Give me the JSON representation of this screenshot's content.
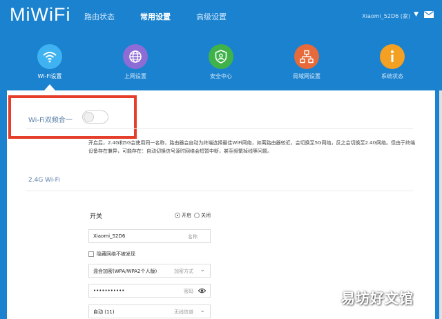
{
  "header": {
    "logo": "MiWiFi",
    "nav": [
      "路由状态",
      "常用设置",
      "高级设置"
    ],
    "active_nav": 1,
    "user": "Xiaomi_52D6 (家)",
    "chevron_icon": "chevron-down-icon",
    "mail_icon": "mail-icon"
  },
  "icons": [
    {
      "label": "Wi-Fi设置",
      "icon": "wifi-icon",
      "color": "#3fb3f2"
    },
    {
      "label": "上网设置",
      "icon": "globe-icon",
      "color": "#8e6cd6"
    },
    {
      "label": "安全中心",
      "icon": "shield-icon",
      "color": "#3fb34a"
    },
    {
      "label": "局域网设置",
      "icon": "network-icon",
      "color": "#e76a3a"
    },
    {
      "label": "系统状态",
      "icon": "info-icon",
      "color": "#f3a023"
    }
  ],
  "dual_band": {
    "label": "Wi-Fi双频合一",
    "enabled": false,
    "description": "开启后，2.4G和5G会使用同一名称，路由器会自动为终端选择最佳WiFi网络，如离路由器较近，会切换至5G网络，反之会切换至2.4G网络。但由于终端设备存在兼异，可能存在：自动切换信号源时网络会短暂中断，甚至频繁掉线等问题。"
  },
  "wifi24": {
    "title": "2.4G Wi-Fi",
    "switch_label": "开关",
    "on_label": "开启",
    "off_label": "关闭",
    "name_value": "Xiaomi_52D6",
    "name_hint": "名称",
    "hide_label": "隐藏网络不被发现",
    "encryption_value": "混合加密(WPA/WPA2个人版)",
    "encryption_hint": "加密方式",
    "password_value": "•••••••••••",
    "password_hint": "密码",
    "channel_value": "自动 (11)",
    "channel_hint": "无线信道"
  },
  "colors": {
    "background": "#1b82cf",
    "highlight_border": "#e53e2b",
    "label_blue": "#5a7ea8"
  },
  "watermark": "易坊好文馆"
}
